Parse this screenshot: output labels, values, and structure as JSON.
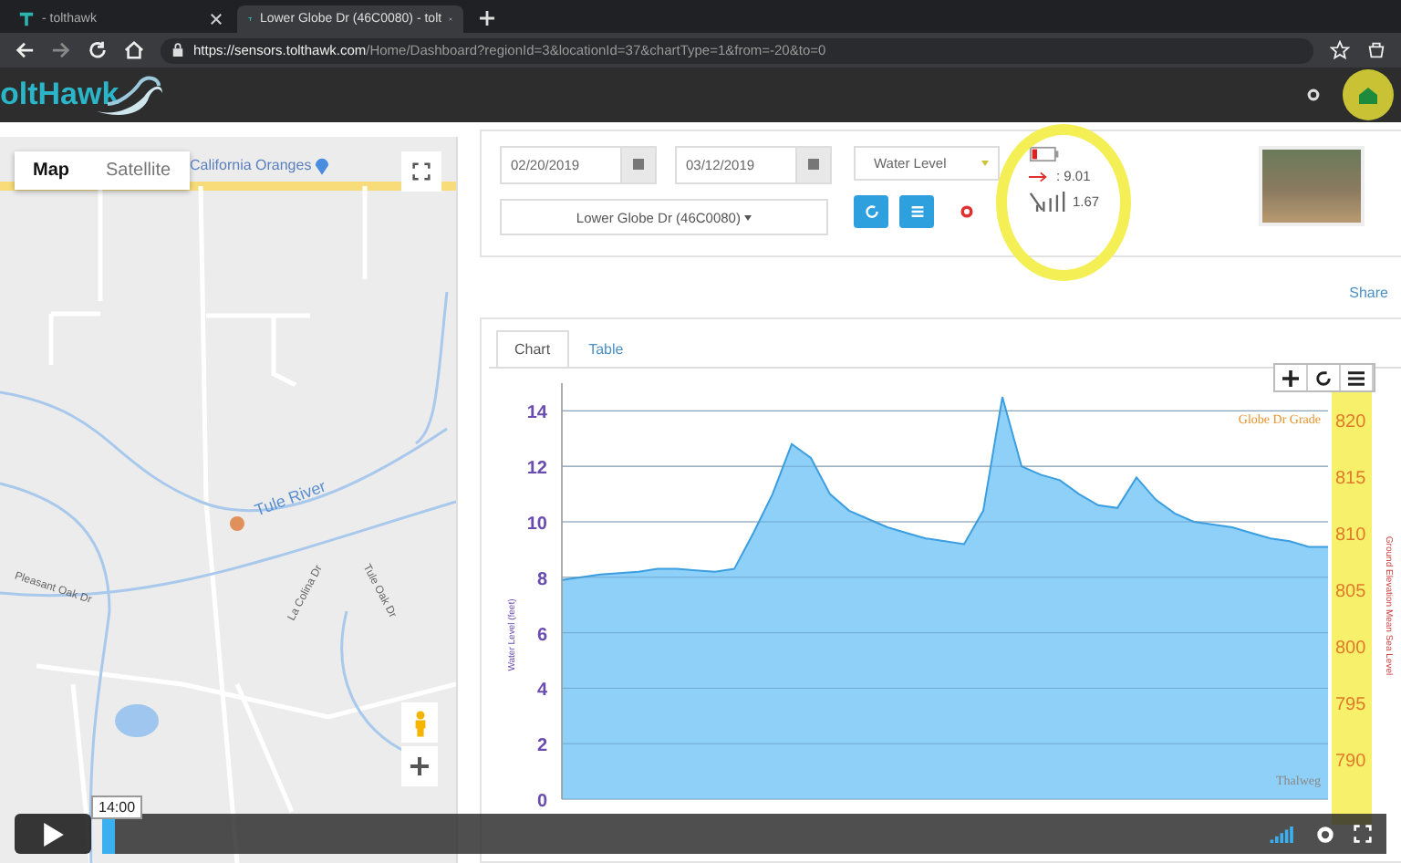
{
  "browser": {
    "tabs": [
      {
        "title": "- tolthawk",
        "selected": false
      },
      {
        "title": "Lower Globe Dr (46C0080) - tolt",
        "selected": true
      }
    ],
    "url_host": "https://sensors.tolthawk.com",
    "url_path": "/Home/Dashboard?regionId=3&locationId=37&chartType=1&from=-20&to=0"
  },
  "app_header": {
    "logo": "oltHawk"
  },
  "map": {
    "map_types": [
      {
        "label": "Map",
        "selected": true
      },
      {
        "label": "Satellite",
        "selected": false
      }
    ],
    "place_label": "California Oranges",
    "labels": [
      {
        "text": "Tule River",
        "kind": "river"
      },
      {
        "text": "Pleasant Oak Dr",
        "kind": "street"
      },
      {
        "text": "La Colina Dr",
        "kind": "street"
      },
      {
        "text": "Tule Oak Dr",
        "kind": "street"
      }
    ]
  },
  "filters": {
    "start_date": "02/20/2019",
    "end_date": "03/12/2019",
    "measure": "Water Level",
    "location": "Lower Globe Dr (46C0080)",
    "status": {
      "flow_reading": ": 9.01",
      "signal_reading": "1.67"
    }
  },
  "share": "Share",
  "chart_tabs": [
    {
      "label": "Chart",
      "selected": true
    },
    {
      "label": "Table",
      "selected": false
    }
  ],
  "chart": {
    "chart_data": {
      "type": "area",
      "ylabel": "Water Level (feet)",
      "grid": true,
      "ylim": [
        0,
        15
      ],
      "yticks": [
        0,
        2,
        4,
        6,
        8,
        10,
        12,
        14
      ],
      "series": [
        {
          "color": "#8fd0f8",
          "values": [
            7.9,
            8.0,
            8.1,
            8.15,
            8.2,
            8.3,
            8.3,
            8.25,
            8.2,
            8.3,
            9.6,
            11.0,
            12.8,
            12.3,
            11.0,
            10.4,
            10.1,
            9.8,
            9.6,
            9.4,
            9.3,
            9.2,
            10.4,
            14.5,
            12.0,
            11.7,
            11.5,
            11.0,
            10.6,
            10.5,
            11.6,
            10.8,
            10.3,
            10.0,
            9.9,
            9.8,
            9.6,
            9.4,
            9.3,
            9.1,
            9.1
          ]
        }
      ],
      "annotations": [
        "Globe Dr Grade",
        "Thalweg"
      ]
    },
    "right_axis": {
      "label": "Ground Elevation Mean Sea Level",
      "ticks": [
        "820",
        "815",
        "810",
        "805",
        "800",
        "795",
        "790"
      ]
    }
  },
  "video": {
    "time": "14:00",
    "level": 0.01
  }
}
